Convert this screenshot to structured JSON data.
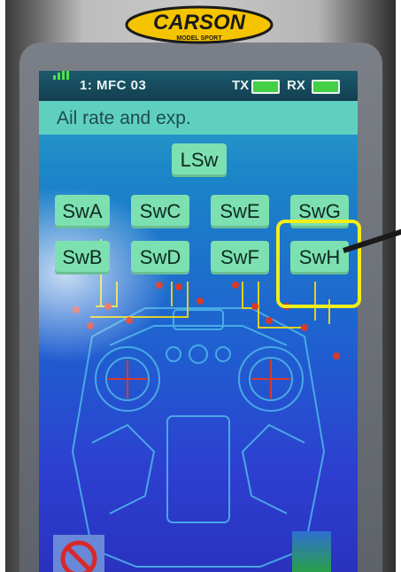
{
  "logo": {
    "brand": "CARSON",
    "subtitle": "MODEL SPORT"
  },
  "status_bar": {
    "model_label": "1: MFC 03",
    "tx_label": "TX",
    "rx_label": "RX"
  },
  "screen_title": "Ail rate and exp.",
  "switch_buttons": [
    "LSw",
    "SwA",
    "SwB",
    "SwC",
    "SwD",
    "SwE",
    "SwF",
    "SwG",
    "SwH"
  ],
  "colors": {
    "highlight": "#f2ee18",
    "button": "#7de0b0",
    "title_bar": "#5fd0c0",
    "connector": "#d83a2a"
  }
}
